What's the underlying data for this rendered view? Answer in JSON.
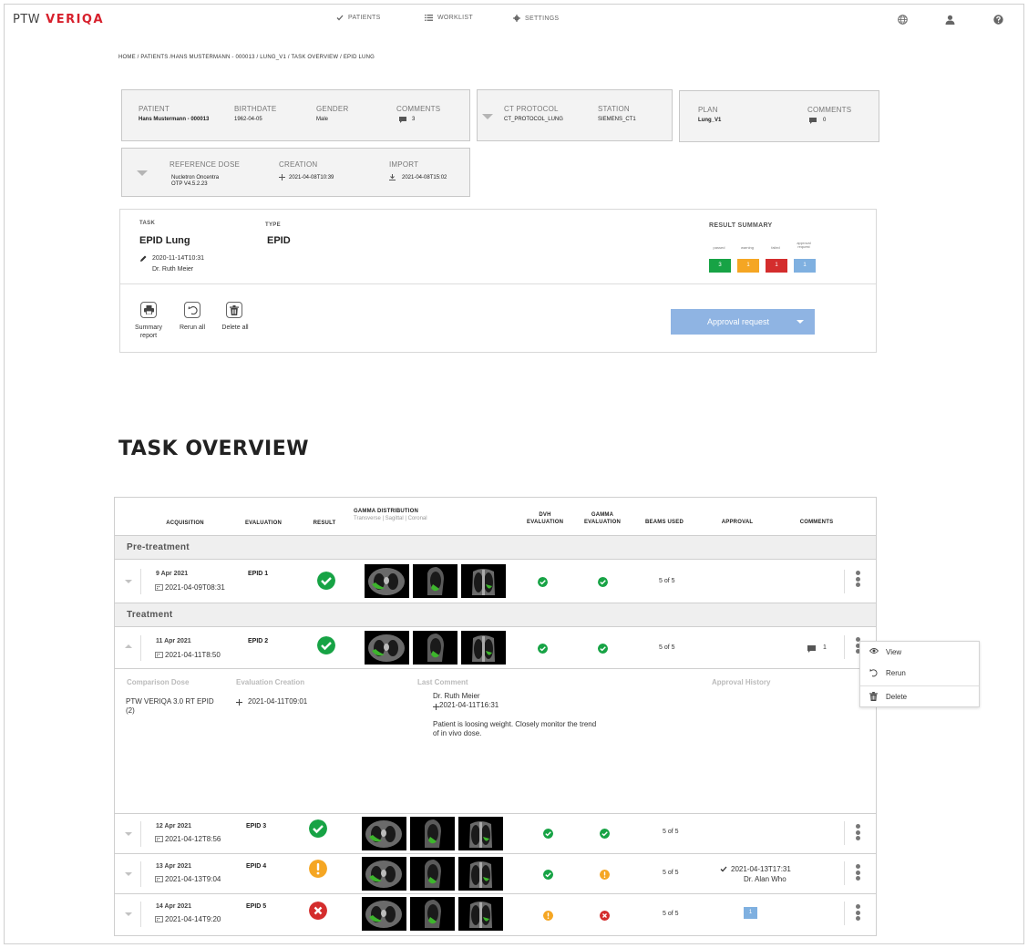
{
  "header": {
    "logo_ptw": "PTW",
    "logo_brand": "VERIQA",
    "nav": [
      {
        "label": "PATIENTS",
        "icon": "check-icon"
      },
      {
        "label": "WORKLIST",
        "icon": "list-icon"
      },
      {
        "label": "SETTINGS",
        "icon": "gear-icon"
      }
    ],
    "icons": [
      "globe-icon",
      "user-icon",
      "help-icon"
    ]
  },
  "breadcrumb": "HOME / PATIENTS /HANS MUSTERMANN - 000013 / LUNG_V1 / TASK OVERVIEW / EPID LUNG",
  "patient_card": {
    "patient_label": "PATIENT",
    "patient_value": "Hans Mustermann - 000013",
    "birthdate_label": "BIRTHDATE",
    "birthdate_value": "1962-04-05",
    "gender_label": "GENDER",
    "gender_value": "Male",
    "comments_label": "COMMENTS",
    "comments_value": "3"
  },
  "ct_card": {
    "protocol_label": "CT PROTOCOL",
    "protocol_value": "CT_PROTOCOL_LUNG",
    "station_label": "STATION",
    "station_value": "SIEMENS_CT1"
  },
  "plan_card": {
    "plan_label": "PLAN",
    "plan_value": "Lung_V1",
    "comments_label": "COMMENTS",
    "comments_value": "0"
  },
  "dose_card": {
    "ref_label": "REFERENCE DOSE",
    "ref_value_1": "Nucletron Oncentra",
    "ref_value_2": "OTP V4.5.2.23",
    "creation_label": "CREATION",
    "creation_value": "2021-04-08T10:39",
    "import_label": "IMPORT",
    "import_value": "2021-04-08T15:02"
  },
  "task": {
    "task_label": "TASK",
    "task_name": "EPID Lung",
    "task_date": "2020-11-14T10:31",
    "task_user": "Dr. Ruth Meier",
    "type_label": "TYPE",
    "type_value": "EPID",
    "summary_label": "RESULT SUMMARY",
    "summary_labels": [
      "passed",
      "warning",
      "failed",
      "approval request"
    ],
    "summary_values": [
      "3",
      "1",
      "1",
      "1"
    ],
    "summary_colors": [
      "#17a345",
      "#f5a623",
      "#d42d2d",
      "#7fb0e0"
    ],
    "buttons": [
      {
        "label1": "Summary",
        "label2": "report",
        "icon": "printer-icon"
      },
      {
        "label1": "Rerun all",
        "label2": "",
        "icon": "rerun-icon"
      },
      {
        "label1": "Delete all",
        "label2": "",
        "icon": "trash-icon"
      }
    ],
    "approval_button": "Approval request"
  },
  "overview": {
    "title": "TASK OVERVIEW",
    "columns": {
      "acquisition": "ACQUISITION",
      "evaluation": "EVALUATION",
      "result": "RESULT",
      "gamma_dist": "GAMMA DISTRIBUTION",
      "gamma_dist_sub": "Transverse | Sagittal | Coronal",
      "dvh_1": "DVH",
      "dvh_2": "EVALUATION",
      "gamma_1": "GAMMA",
      "gamma_2": "EVALUATION",
      "beams": "BEAMS USED",
      "approval": "APPROVAL",
      "comments": "COMMENTS"
    },
    "section_pre": "Pre-treatment",
    "section_treat": "Treatment",
    "rows": [
      {
        "date": "9 Apr 2021",
        "stamp": "2021-04-09T08:31",
        "eval": "EPID 1",
        "result": "passed",
        "dvh": "passed",
        "gamma": "passed",
        "beams": "5 of 5"
      },
      {
        "date": "11 Apr 2021",
        "stamp": "2021-04-11T8:50",
        "eval": "EPID 2",
        "result": "passed",
        "dvh": "passed",
        "gamma": "passed",
        "beams": "5 of 5",
        "comments": "1"
      },
      {
        "date": "12 Apr 2021",
        "stamp": "2021-04-12T8:56",
        "eval": "EPID 3",
        "result": "passed",
        "dvh": "passed",
        "gamma": "passed",
        "beams": "5 of 5"
      },
      {
        "date": "13 Apr 2021",
        "stamp": "2021-04-13T9:04",
        "eval": "EPID 4",
        "result": "warning",
        "dvh": "passed",
        "gamma": "warning",
        "beams": "5 of 5",
        "approval_date": "2021-04-13T17:31",
        "approval_user": "Dr. Alan Who"
      },
      {
        "date": "14 Apr 2021",
        "stamp": "2021-04-14T9:20",
        "eval": "EPID 5",
        "result": "failed",
        "dvh": "warning",
        "gamma": "failed",
        "beams": "5 of 5",
        "approval_badge": "1"
      }
    ],
    "detail": {
      "comp_label": "Comparison Dose",
      "comp_value_1": "PTW VERIQA 3.0 RT EPID",
      "comp_value_2": "(2)",
      "creation_label": "Evaluation Creation",
      "creation_value": "2021-04-11T09:01",
      "comment_label": "Last Comment",
      "comment_user": "Dr. Ruth Meier",
      "comment_date": "2021-04-11T16:31",
      "comment_text_1": "Patient is loosing weight. Closely monitor the trend",
      "comment_text_2": "of in vivo dose.",
      "history_label": "Approval History"
    },
    "menu": [
      {
        "label": "View",
        "icon": "eye-icon"
      },
      {
        "label": "Rerun",
        "icon": "rerun-icon"
      },
      {
        "label": "Delete",
        "icon": "trash-icon"
      }
    ]
  }
}
